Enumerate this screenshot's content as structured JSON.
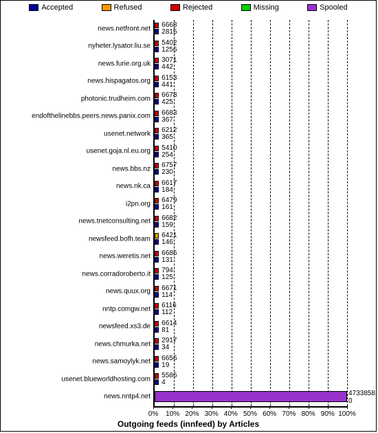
{
  "chart_data": {
    "type": "bar",
    "title": "Outgoing feeds (innfeed) by Articles",
    "legend": [
      {
        "name": "Accepted",
        "color": "#000099"
      },
      {
        "name": "Refused",
        "color": "#ff9900"
      },
      {
        "name": "Rejected",
        "color": "#cc0000"
      },
      {
        "name": "Missing",
        "color": "#00cc00"
      },
      {
        "name": "Spooled",
        "color": "#9933cc"
      }
    ],
    "x_ticks": [
      "0%",
      "10%",
      "20%",
      "30%",
      "40%",
      "50%",
      "60%",
      "70%",
      "80%",
      "90%",
      "100%"
    ],
    "rows": [
      {
        "host": "news.netfront.net",
        "top_color": "#cc0000",
        "top_val": 6668,
        "bot_val": 2815
      },
      {
        "host": "nyheter.lysator.liu.se",
        "top_color": "#cc0000",
        "top_val": 5402,
        "bot_val": 1256
      },
      {
        "host": "news.furie.org.uk",
        "top_color": "#cc0000",
        "top_val": 3071,
        "bot_val": 442
      },
      {
        "host": "news.hispagatos.org",
        "top_color": "#cc0000",
        "top_val": 6153,
        "bot_val": 441
      },
      {
        "host": "photonic.trudheim.com",
        "top_color": "#cc0000",
        "top_val": 6678,
        "bot_val": 425
      },
      {
        "host": "endofthelinebbs.peers.news.panix.com",
        "top_color": "#cc0000",
        "top_val": 6683,
        "bot_val": 367
      },
      {
        "host": "usenet.network",
        "top_color": "#cc0000",
        "top_val": 6212,
        "bot_val": 365
      },
      {
        "host": "usenet.goja.nl.eu.org",
        "top_color": "#cc0000",
        "top_val": 5410,
        "bot_val": 254
      },
      {
        "host": "news.bbs.nz",
        "top_color": "#cc0000",
        "top_val": 6757,
        "bot_val": 230
      },
      {
        "host": "news.nk.ca",
        "top_color": "#cc0000",
        "top_val": 6617,
        "bot_val": 184
      },
      {
        "host": "i2pn.org",
        "top_color": "#cc0000",
        "top_val": 6479,
        "bot_val": 161
      },
      {
        "host": "news.tnetconsulting.net",
        "top_color": "#cc0000",
        "top_val": 6682,
        "bot_val": 159
      },
      {
        "host": "newsfeed.bofh.team",
        "top_color": "#ff9900",
        "top_val": 6421,
        "bot_val": 146
      },
      {
        "host": "news.weretis.net",
        "top_color": "#cc0000",
        "top_val": 6686,
        "bot_val": 131
      },
      {
        "host": "news.corradoroberto.it",
        "top_color": "#cc0000",
        "top_val": 794,
        "bot_val": 125
      },
      {
        "host": "news.quux.org",
        "top_color": "#cc0000",
        "top_val": 6671,
        "bot_val": 114
      },
      {
        "host": "nntp.comgw.net",
        "top_color": "#cc0000",
        "top_val": 6116,
        "bot_val": 112
      },
      {
        "host": "newsfeed.xs3.de",
        "top_color": "#cc0000",
        "top_val": 6614,
        "bot_val": 81
      },
      {
        "host": "news.chmurka.net",
        "top_color": "#cc0000",
        "top_val": 2917,
        "bot_val": 34
      },
      {
        "host": "news.samoylyk.net",
        "top_color": "#cc0000",
        "top_val": 6656,
        "bot_val": 19
      },
      {
        "host": "usenet.blueworldhosting.com",
        "top_color": "#cc0000",
        "top_val": 5586,
        "bot_val": 4
      },
      {
        "host": "news.nntp4.net",
        "top_color": "#9933cc",
        "top_val": 4733858,
        "bot_val": 0,
        "full": true
      }
    ]
  }
}
